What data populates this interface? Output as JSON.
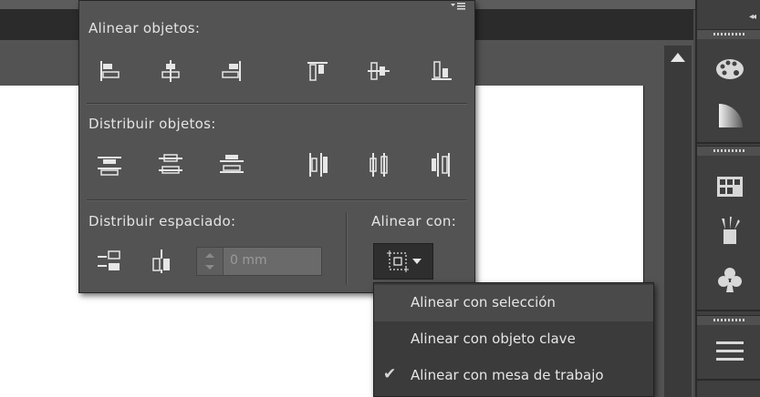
{
  "align_panel": {
    "align_objects_label": "Alinear objetos:",
    "distribute_objects_label": "Distribuir objetos:",
    "distribute_spacing_label": "Distribuir espaciado:",
    "align_to_label": "Alinear con:",
    "spacing_value": "0 mm",
    "menu_icon": "panel-menu-icon"
  },
  "align_to_menu": {
    "items": [
      {
        "label": "Alinear con selección",
        "checked": false,
        "highlighted": true
      },
      {
        "label": "Alinear con objeto clave",
        "checked": false,
        "highlighted": false
      },
      {
        "label": "Alinear con mesa de trabajo",
        "checked": true,
        "highlighted": false
      }
    ],
    "check_glyph": "✔"
  },
  "dock": {
    "collapse_glyph": "◂◂",
    "icons": [
      "color-palette-icon",
      "gradient-icon",
      "swatches-icon",
      "brushes-icon",
      "symbols-icon",
      "stroke-icon"
    ]
  }
}
